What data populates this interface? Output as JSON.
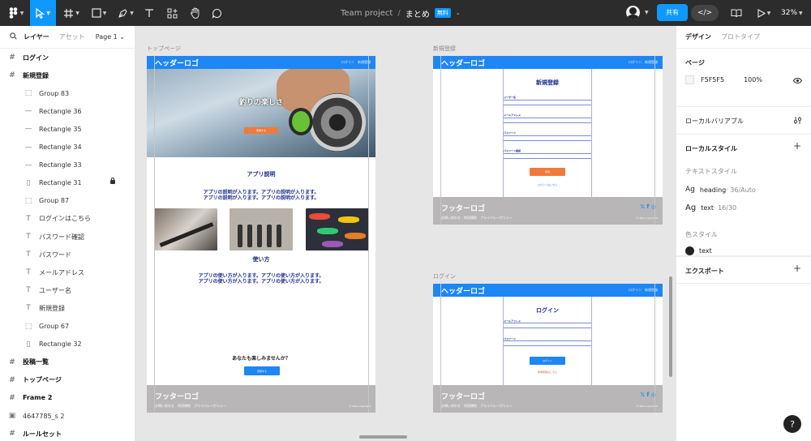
{
  "toolbar": {
    "project": "Team project",
    "file": "まとめ",
    "badge": "無料",
    "share": "共有",
    "zoom": "32%"
  },
  "left_panel": {
    "tab_layers": "レイヤー",
    "tab_assets": "アセット",
    "page": "Page 1 ⌄",
    "layers": [
      {
        "icon": "#",
        "label": "ログイン",
        "indent": 0,
        "top": true
      },
      {
        "icon": "#",
        "label": "新規登録",
        "indent": 0,
        "top": true
      },
      {
        "icon": "⬚",
        "label": "Group 83",
        "indent": 1
      },
      {
        "icon": "—",
        "label": "Rectangle 36",
        "indent": 1
      },
      {
        "icon": "—",
        "label": "Rectangle 35",
        "indent": 1
      },
      {
        "icon": "—",
        "label": "Rectangle 34",
        "indent": 1
      },
      {
        "icon": "—",
        "label": "Rectangle 33",
        "indent": 1
      },
      {
        "icon": "▯",
        "label": "Rectangle 31",
        "indent": 1,
        "locked": true
      },
      {
        "icon": "⬚",
        "label": "Group 87",
        "indent": 1
      },
      {
        "icon": "T",
        "label": "ログインはこちら",
        "indent": 1
      },
      {
        "icon": "T",
        "label": "パスワード確認",
        "indent": 1
      },
      {
        "icon": "T",
        "label": "パスワード",
        "indent": 1
      },
      {
        "icon": "T",
        "label": "メールアドレス",
        "indent": 1
      },
      {
        "icon": "T",
        "label": "ユーザー名",
        "indent": 1
      },
      {
        "icon": "T",
        "label": "新規登録",
        "indent": 1
      },
      {
        "icon": "⬚",
        "label": "Group 67",
        "indent": 1
      },
      {
        "icon": "▯",
        "label": "Rectangle 32",
        "indent": 1
      },
      {
        "icon": "#",
        "label": "投稿一覧",
        "indent": 0,
        "top": true
      },
      {
        "icon": "#",
        "label": "トップページ",
        "indent": 0,
        "top": true
      },
      {
        "icon": "#",
        "label": "Frame 2",
        "indent": 0,
        "top": true
      },
      {
        "icon": "▣",
        "label": "4647785_s 2",
        "indent": 0
      },
      {
        "icon": "#",
        "label": "ルールセット",
        "indent": 0,
        "top": true
      }
    ]
  },
  "canvas": {
    "top_label": "トップページ",
    "signup_label": "新規登録",
    "login_label": "ログイン",
    "header_logo": "ヘッダーロゴ",
    "header_nav": "ログイン　新規登録",
    "footer_logo": "フッターロゴ",
    "footer_links": "お問い合わせ　利用規約　プライバシーポリシー",
    "footer_social": "𝕏 f ◎",
    "footer_copy": "© 20xx copyright",
    "hero_title": "釣りの楽しさ",
    "hero_button": "登録する",
    "app_title": "アプリ説明",
    "app_body_1": "アプリの説明が入ります。アプリの説明が入ります。",
    "app_body_2": "アプリの説明が入ります。アプリの説明が入ります。",
    "usage_title": "使い方",
    "usage_body_1": "アプリの使い方が入ります。アプリの使い方が入ります。",
    "usage_body_2": "アプリの使い方が入ります。アプリの使い方が入ります。",
    "cta_title": "あなたも楽しみませんか？",
    "cta_button": "登録する",
    "signup_title": "新規登録",
    "signup_user": "ユーザー名",
    "signup_email": "メールアドレス",
    "signup_password": "パスワード",
    "signup_confirm": "パスワード確認",
    "signup_button": "登録",
    "signup_link": "ログインはこちら",
    "login_title": "ログイン",
    "login_email": "メールアドレス",
    "login_password": "パスワード",
    "login_button": "ログイン",
    "login_link": "新規登録はこちら"
  },
  "right_panel": {
    "tab_design": "デザイン",
    "tab_prototype": "プロトタイプ",
    "page_title": "ページ",
    "page_color": "F5F5F5",
    "page_opacity": "100%",
    "local_variables": "ローカルバリアブル",
    "local_styles": "ローカルスタイル",
    "text_styles": "テキストスタイル",
    "style_heading_name": "heading",
    "style_heading_meta": " · 36/Auto",
    "style_text_name": "text",
    "style_text_meta": " · 16/30",
    "color_styles": "色スタイル",
    "color_text": "text",
    "export": "エクスポート"
  },
  "colors": {
    "accent": "#0d99ff",
    "header": "#1e86f5",
    "footer": "#b8b6b6",
    "heading_text": "#1a2b8f",
    "orange_button": "#f07a3a"
  }
}
